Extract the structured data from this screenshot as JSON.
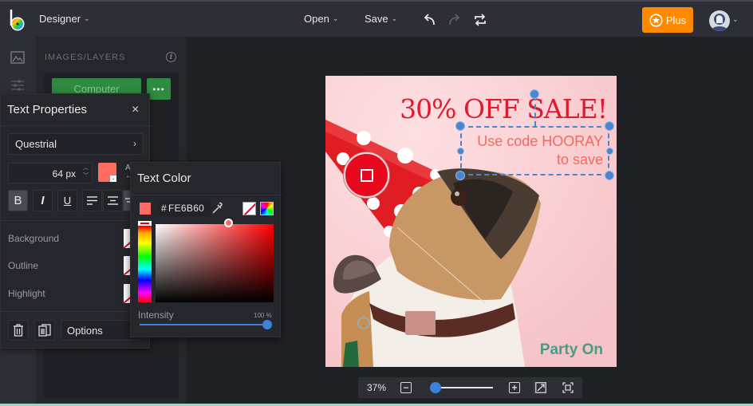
{
  "topbar": {
    "app_menu_label": "Designer",
    "open_label": "Open",
    "save_label": "Save",
    "plus_label": "Plus",
    "icons": [
      "logo-icon",
      "undo-icon",
      "redo-icon",
      "repeat-icon",
      "star-icon",
      "avatar-icon"
    ],
    "accent_color": "#ff8a00"
  },
  "rail": {
    "icons": [
      "image-icon",
      "sliders-icon"
    ]
  },
  "images_panel": {
    "title": "IMAGES/LAYERS",
    "computer_button": "Computer",
    "more_button": "•••"
  },
  "text_properties": {
    "title": "Text Properties",
    "close_label": "×",
    "font": "Questrial",
    "font_arrow": "›",
    "size": "64 px",
    "text_color": "#FE6B60",
    "format_buttons": [
      "B",
      "I",
      "U"
    ],
    "bold_active": true,
    "rows": [
      {
        "label": "Background"
      },
      {
        "label": "Outline"
      },
      {
        "label": "Highlight"
      }
    ],
    "options_label": "Options"
  },
  "text_color_popup": {
    "title": "Text Color",
    "hex_prefix": "#",
    "hex_value": "FE6B60",
    "intensity_label": "Intensity",
    "intensity_value": "100 %",
    "intensity_fraction": 1.0
  },
  "canvas": {
    "headline": "30% OFF SALE!",
    "subline_1": "Use code HOORAY",
    "subline_2": "to save",
    "footer": "Party On",
    "headline_color": "#e2192c",
    "subline_color": "#ef6b60",
    "footer_color": "#4a9b86",
    "background_color": "#f8cbcf"
  },
  "zoom": {
    "percent": "37%",
    "minus": "−",
    "plus": "+",
    "slider_fraction": 0.1
  }
}
